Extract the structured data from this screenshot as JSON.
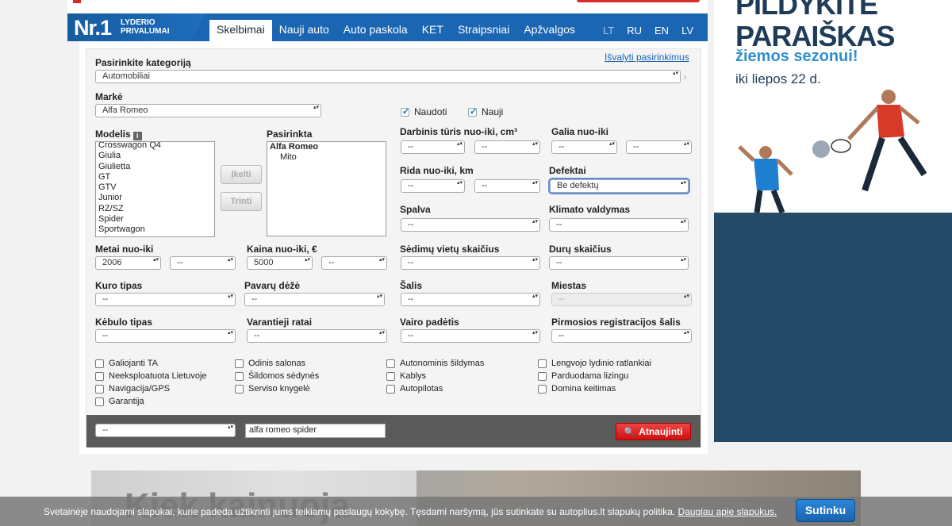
{
  "nav": {
    "logo_nr": "Nr.1",
    "logo_line1": "LYDERIO",
    "logo_line2": "PRIVALUMAI",
    "tabs": [
      "Skelbimai",
      "Nauji auto",
      "Auto paskola",
      "KET",
      "Straipsniai",
      "Apžvalgos"
    ],
    "active_tab": "Skelbimai",
    "languages": [
      "LT",
      "RU",
      "EN",
      "LV"
    ],
    "active_language": "LT"
  },
  "form": {
    "category_label": "Pasirinkite kategoriją",
    "category_value": "Automobiliai",
    "clear_link": "Išvalyti pasirinkimus",
    "make_label": "Markė",
    "make_value": "Alfa Romeo",
    "used_label": "Naudoti",
    "new_label": "Nauji",
    "used_checked": true,
    "new_checked": true,
    "models_label": "Modelis",
    "info_icon": "i",
    "models": [
      "Crosswagon Q4",
      "Giulia",
      "Giulietta",
      "GT",
      "GTV",
      "Junior",
      "RZ/SZ",
      "Spider",
      "Sportwagon"
    ],
    "add_button": "Įkelti",
    "remove_button": "Trinti",
    "selected_label": "Pasirinkta",
    "selected_make": "Alfa Romeo",
    "selected_model": "Mito",
    "engine_label": "Darbinis tūris nuo-iki, cm³",
    "power_label": "Galia nuo-iki",
    "mileage_label": "Rida nuo-iki, km",
    "defects_label": "Defektai",
    "defects_value": "Be defektų",
    "color_label": "Spalva",
    "climate_label": "Klimato valdymas",
    "year_label": "Metai nuo-iki",
    "year_from": "2006",
    "price_label": "Kaina nuo-iki, €",
    "price_from": "5000",
    "seats_label": "Sėdimų vietų skaičius",
    "doors_label": "Durų skaičius",
    "fuel_label": "Kuro tipas",
    "gearbox_label": "Pavarų dėžė",
    "country_label": "Šalis",
    "city_label": "Miestas",
    "body_label": "Kėbulo tipas",
    "drive_label": "Varantieji ratai",
    "steering_label": "Vairo padėtis",
    "first_reg_label": "Pirmosios registracijos šalis",
    "empty": "--",
    "features": [
      [
        "Galiojanti TA",
        "Neeksploatuota Lietuvoje",
        "Navigacija/GPS",
        "Garantija"
      ],
      [
        "Odinis salonas",
        "Šildomos sėdynės",
        "Serviso knygelė"
      ],
      [
        "Autonominis šildymas",
        "Kablys",
        "Autopilotas"
      ],
      [
        "Lengvojo lydinio ratlankiai",
        "Parduodama lizingu",
        "Domina keitimas"
      ]
    ],
    "sort_value": "--",
    "search_text": "alfa romeo spider",
    "refresh_button": "Atnaujinti"
  },
  "ad": {
    "headline1": "PILDYKITE",
    "headline2": "PARAIŠKAS",
    "subline": "žiemos sezonui!",
    "date": "iki liepos 22 d."
  },
  "hero": {
    "text": "Kiek kainuoja"
  },
  "cookie": {
    "message": "Svetainėje naudojami slapukai, kurie padeda užtikrinti jums teikiamų paslaugų kokybę. Tęsdami naršymą, jūs sutinkate su autoplius.lt slapukų politika.",
    "more": "Daugiau apie slapukus.",
    "accept": "Sutinku"
  },
  "colors": {
    "nav_blue": "#1b66b3",
    "ad_dark": "#234a66",
    "red_button": "#d82b2b"
  }
}
